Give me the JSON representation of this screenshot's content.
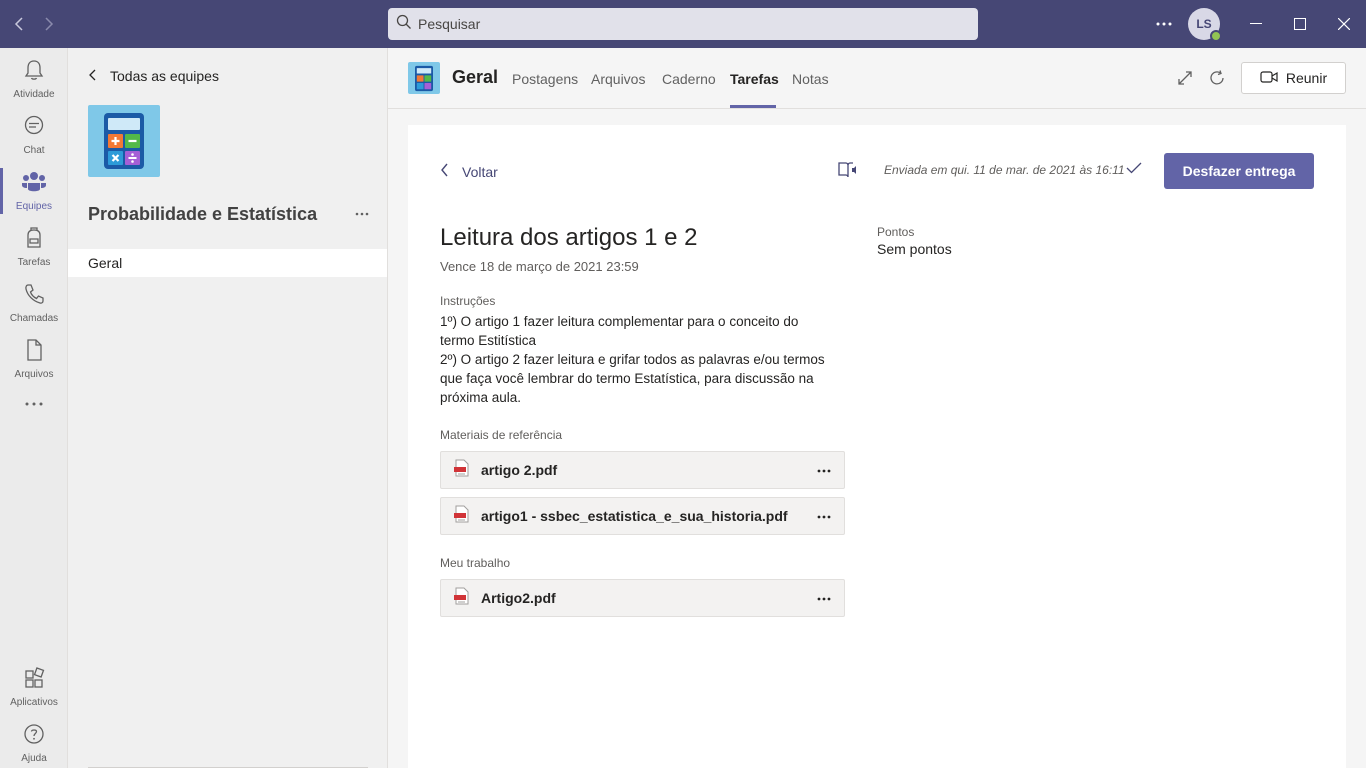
{
  "titlebar": {
    "search_placeholder": "Pesquisar",
    "avatar_initials": "LS"
  },
  "rail": {
    "items": [
      {
        "label": "Atividade",
        "icon": "bell-icon"
      },
      {
        "label": "Chat",
        "icon": "chat-icon"
      },
      {
        "label": "Equipes",
        "icon": "teams-icon",
        "active": true
      },
      {
        "label": "Tarefas",
        "icon": "backpack-icon"
      },
      {
        "label": "Chamadas",
        "icon": "phone-icon"
      },
      {
        "label": "Arquivos",
        "icon": "file-icon"
      }
    ],
    "bottom": [
      {
        "label": "Aplicativos",
        "icon": "apps-icon"
      },
      {
        "label": "Ajuda",
        "icon": "help-icon"
      }
    ]
  },
  "teampanel": {
    "back_label": "Todas as equipes",
    "team_name": "Probabilidade e Estatística",
    "channel": "Geral"
  },
  "channel_header": {
    "title": "Geral",
    "tabs": [
      "Postagens",
      "Arquivos",
      "Caderno",
      "Tarefas",
      "Notas"
    ],
    "active_tab": "Tarefas",
    "meet_label": "Reunir"
  },
  "assignment": {
    "back_label": "Voltar",
    "sent_text": "Enviada em qui. 11 de mar. de 2021 às 16:11",
    "undo_label": "Desfazer entrega",
    "title": "Leitura dos artigos 1 e 2",
    "due": "Vence 18 de março de 2021 23:59",
    "instructions_label": "Instruções",
    "instructions": [
      "1º) O artigo 1 fazer leitura complementar para o conceito do termo Estitística",
      "2º) O artigo 2 fazer leitura e grifar todos as palavras e/ou termos que faça você lembrar do termo Estatística, para discussão na próxima aula."
    ],
    "points_label": "Pontos",
    "points_value": "Sem pontos",
    "reference_label": "Materiais de referência",
    "reference_files": [
      "artigo 2.pdf",
      "artigo1 - ssbec_estatistica_e_sua_historia.pdf"
    ],
    "my_work_label": "Meu trabalho",
    "my_work_files": [
      "Artigo2.pdf"
    ]
  },
  "colors": {
    "titlebar": "#464775",
    "accent": "#6264a7",
    "team_logo_bg": "#7fc8e8"
  }
}
